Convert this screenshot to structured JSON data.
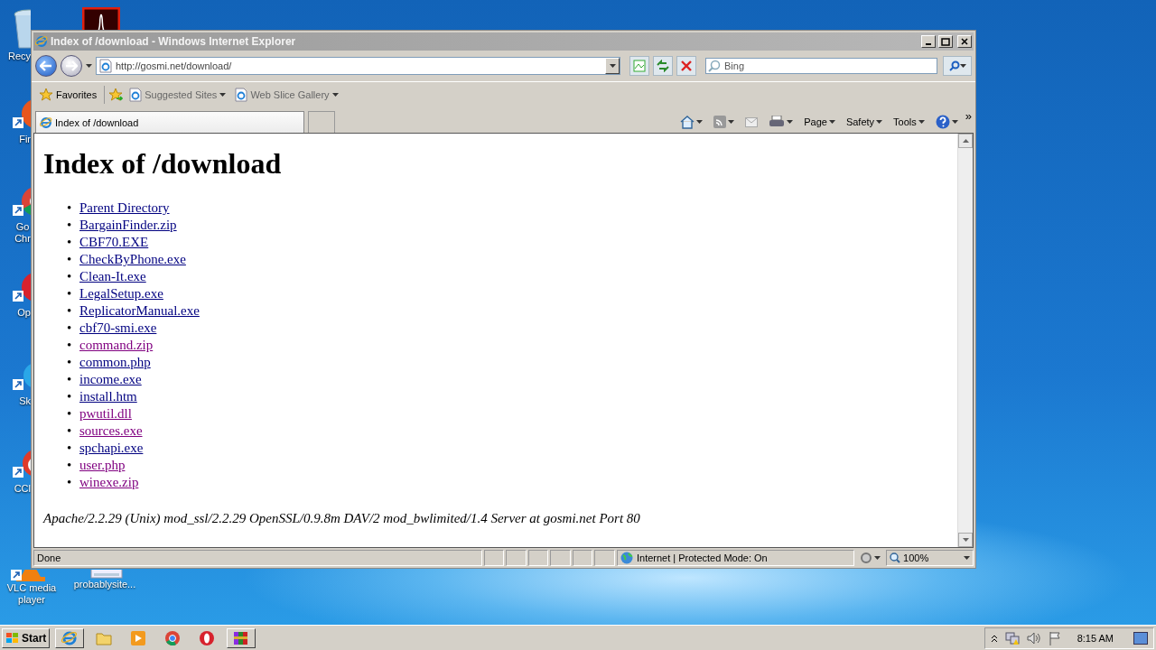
{
  "desktop_icons": [
    {
      "kind": "bin",
      "label": "Recy"
    },
    {
      "kind": "pdf"
    },
    {
      "kind": "firefox",
      "label": "Fir"
    },
    {
      "kind": "chrome",
      "label": "Go Chr"
    },
    {
      "kind": "opera",
      "label": "Op"
    },
    {
      "kind": "skype",
      "label": "Sk"
    },
    {
      "kind": "ccleaner",
      "label": "CCl"
    },
    {
      "kind": "vlc",
      "label": "VLC media player"
    },
    {
      "kind": "file",
      "label": "probablysite..."
    }
  ],
  "window": {
    "title": "Index of /download - Windows Internet Explorer",
    "address": "http://gosmi.net/download/",
    "search": {
      "placeholder": "Bing"
    },
    "favorites": {
      "label": "Favorites",
      "links": [
        "Suggested Sites",
        "Web Slice Gallery"
      ]
    },
    "tabs": [
      {
        "label": "Index of /download",
        "selected": true
      }
    ],
    "commands": [
      "Page",
      "Safety",
      "Tools"
    ],
    "overflow": "»",
    "page": {
      "heading": "Index of /download",
      "bullet": "•",
      "links": [
        {
          "text": "Parent Directory",
          "visited": false
        },
        {
          "text": "BargainFinder.zip",
          "visited": false
        },
        {
          "text": "CBF70.EXE",
          "visited": false
        },
        {
          "text": "CheckByPhone.exe",
          "visited": false
        },
        {
          "text": "Clean-It.exe",
          "visited": false
        },
        {
          "text": "LegalSetup.exe",
          "visited": false
        },
        {
          "text": "ReplicatorManual.exe",
          "visited": false
        },
        {
          "text": "cbf70-smi.exe",
          "visited": false
        },
        {
          "text": "command.zip",
          "visited": true
        },
        {
          "text": "common.php",
          "visited": false
        },
        {
          "text": "income.exe",
          "visited": false
        },
        {
          "text": "install.htm",
          "visited": false
        },
        {
          "text": "pwutil.dll",
          "visited": true
        },
        {
          "text": "sources.exe",
          "visited": true
        },
        {
          "text": "spchapi.exe",
          "visited": false
        },
        {
          "text": "user.php",
          "visited": true
        },
        {
          "text": "winexe.zip",
          "visited": true
        }
      ],
      "footer": "Apache/2.2.29 (Unix) mod_ssl/2.2.29 OpenSSL/0.9.8m DAV/2 mod_bwlimited/1.4 Server at gosmi.net Port 80"
    },
    "status_bar": {
      "status": "Done",
      "zone": "Internet | Protected Mode: On",
      "zoom": "100%"
    }
  },
  "taskbar": {
    "start": "Start",
    "clock": "8:15 AM"
  }
}
